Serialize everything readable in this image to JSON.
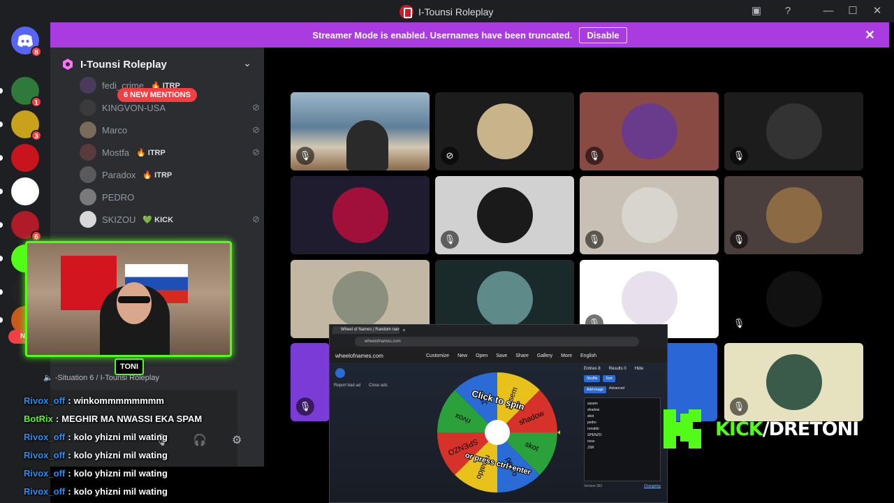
{
  "window": {
    "title": "I-Tounsi Roleplay",
    "icons": [
      "inbox-icon",
      "help-icon",
      "minimize-icon",
      "maximize-icon",
      "close-icon"
    ]
  },
  "banner": {
    "message": "Streamer Mode is enabled. Usernames have been truncated.",
    "disable_label": "Disable",
    "close_label": "✕",
    "color": "#a93be0"
  },
  "server_rail": {
    "home_badge": "8",
    "servers": [
      {
        "badge": "1",
        "color": "#2d7a3a"
      },
      {
        "badge": "3",
        "color": "#c8a21a"
      },
      {
        "badge": "",
        "color": "#c8151d"
      },
      {
        "badge": "",
        "color": "#ffffff"
      },
      {
        "badge": "6",
        "color": "#b01b28"
      },
      {
        "badge": "",
        "color": "#53fc18"
      },
      {
        "badge": "",
        "color": "#222222"
      },
      {
        "badge": "",
        "color": "#c85a1a"
      }
    ],
    "new_pill": "NE"
  },
  "sidebar": {
    "server_name": "I-Tounsi Roleplay",
    "mentions_pill": "6 NEW MENTIONS",
    "members": [
      {
        "name": "fedi_crime",
        "tag": "ITRP",
        "muted": false
      },
      {
        "name": "KINGVON-USA",
        "tag": "",
        "muted": true
      },
      {
        "name": "Marco",
        "tag": "",
        "muted": true
      },
      {
        "name": "Mostfa",
        "tag": "ITRP",
        "muted": true
      },
      {
        "name": "Paradox",
        "tag": "ITRP",
        "muted": false
      },
      {
        "name": "PEDRO",
        "tag": "",
        "muted": false
      },
      {
        "name": "SKIZOU",
        "tag": "KICK",
        "muted": true
      }
    ],
    "voice_status": "-Situation 6 / I-Tounsi Roleplay"
  },
  "webcam": {
    "tag": "TONI",
    "accent": "#53fc18"
  },
  "chat": [
    {
      "user": "Rivox_off",
      "message": "winkommmmmmmm",
      "bot": false
    },
    {
      "user": "BotRix",
      "message": "MEGHIR MA NWASSI EKA SPAM",
      "bot": true
    },
    {
      "user": "Rivox_off",
      "message": "kolo yhizni mil wating",
      "bot": false
    },
    {
      "user": "Rivox_off",
      "message": "kolo yhizni mil wating",
      "bot": false
    },
    {
      "user": "Rivox_off",
      "message": "kolo yhizni mil wating",
      "bot": false
    },
    {
      "user": "Rivox_off",
      "message": "kolo yhizni mil wating",
      "bot": false
    }
  ],
  "tiles": [
    {
      "bg": "#5e7f99",
      "avatar": "#2a2a2a",
      "mic": "mic-muted-icon",
      "kind": "camera"
    },
    {
      "bg": "#1c1c1c",
      "avatar": "#c9b38a",
      "mic": "eye-off-icon",
      "kind": "avatar"
    },
    {
      "bg": "#8a4a44",
      "avatar": "#6a3b8c",
      "mic": "mic-muted-icon",
      "kind": "avatar"
    },
    {
      "bg": "#1c1c1c",
      "avatar": "#333333",
      "mic": "mic-muted-icon",
      "kind": "avatar"
    },
    {
      "bg": "#1e1c2e",
      "avatar": "#a0103a",
      "mic": "",
      "kind": "avatar"
    },
    {
      "bg": "#d1d1d1",
      "avatar": "#1a1a1a",
      "mic": "mic-muted-icon",
      "kind": "avatar"
    },
    {
      "bg": "#c8c0b4",
      "avatar": "#d8d4ce",
      "mic": "mic-muted-icon",
      "kind": "avatar"
    },
    {
      "bg": "#4a3f3d",
      "avatar": "#8b6a44",
      "mic": "mic-muted-icon",
      "kind": "avatar"
    },
    {
      "bg": "#c2b7a3",
      "avatar": "#8a8f7e",
      "mic": "",
      "kind": "avatar"
    },
    {
      "bg": "#1a2a2a",
      "avatar": "#5e8a8a",
      "mic": "",
      "kind": "avatar"
    },
    {
      "bg": "#ffffff",
      "avatar": "#e8e0ec",
      "mic": "mic-muted-icon",
      "kind": "avatar"
    },
    {
      "bg": "#000000",
      "avatar": "#111111",
      "mic": "mic-muted-icon",
      "kind": "avatar"
    },
    {
      "bg": "#7a3bd6",
      "avatar": "#7a3bd6",
      "mic": "mic-muted-icon",
      "kind": "partial"
    },
    {
      "bg": "#2a66d6",
      "avatar": "#2a66d6",
      "mic": "",
      "kind": "partial"
    },
    {
      "bg": "#e6e1bf",
      "avatar": "#3a5a4a",
      "mic": "mic-muted-icon",
      "kind": "avatar"
    }
  ],
  "browser": {
    "tab_title": "Wheel of Names | Random nam",
    "url": "wheelofnames.com",
    "site_logo": "wheelofnames.com",
    "nav": [
      "Customize",
      "New",
      "Open",
      "Save",
      "Share",
      "Gallery",
      "More",
      "English"
    ],
    "links": [
      "Report bad ad",
      "Close ads"
    ],
    "wheel_center_text": "Click to spin",
    "wheel_sub_text": "or press ctrl+enter",
    "entries_tab": "Entries",
    "entries_count": "8",
    "results_tab": "Results",
    "results_count": "0",
    "hide_label": "Hide",
    "shuffle_label": "Shuffle",
    "sort_label": "Sort",
    "add_image_label": "Add image",
    "advanced_label": "Advanced",
    "entries": [
      "sasem",
      "shadow",
      "skot",
      "pedro",
      "ronaldo",
      "SPENZO",
      "rivox",
      "JSR"
    ],
    "version": "Version 381",
    "changelog": "Changelog",
    "wheel_colors": [
      "#e8c21a",
      "#d6322a",
      "#2aa13a",
      "#2a6bd6"
    ]
  },
  "kick": {
    "prefix": "KICK",
    "suffix": "/DRETONI",
    "color": "#53fc18"
  }
}
